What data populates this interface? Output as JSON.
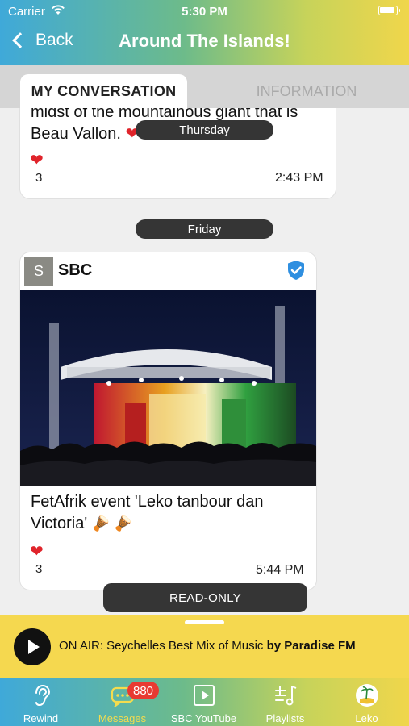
{
  "status_bar": {
    "carrier": "Carrier",
    "time": "5:30 PM"
  },
  "nav": {
    "back_label": "Back",
    "title": "Around The Islands!"
  },
  "tabs": [
    {
      "label": "MY CONVERSATION",
      "active": true
    },
    {
      "label": "INFORMATION",
      "active": false
    }
  ],
  "messages": [
    {
      "text": "midst of the mountainous giant that is Beau Vallon. ",
      "reaction_icon": "heart-icon",
      "reaction_count": "3",
      "time": "2:43 PM"
    },
    {
      "sender_initial": "S",
      "sender": "SBC",
      "image": "concert-stage-photo",
      "text": "FetAfrik event 'Leko tanbour dan Victoria' ",
      "reaction_icon": "heart-icon",
      "reaction_count": "3",
      "time": "5:44 PM"
    }
  ],
  "day_separators": [
    "Thursday",
    "Friday"
  ],
  "read_only_label": "READ-ONLY",
  "player": {
    "prefix": "ON AIR: Seychelles Best Mix of Music ",
    "station": "by Paradise FM"
  },
  "tabbar": {
    "items": [
      {
        "label": "Rewind",
        "icon": "ear-icon"
      },
      {
        "label": "Messages",
        "icon": "chat-bubble-icon",
        "badge": "880",
        "active": true
      },
      {
        "label": "SBC YouTube",
        "icon": "play-square-icon"
      },
      {
        "label": "Playlists",
        "icon": "playlist-icon"
      },
      {
        "label": "Leko",
        "icon": "leko-logo-icon"
      }
    ]
  },
  "colors": {
    "header_start": "#3fa9d9",
    "header_end": "#f0d64b",
    "player_bg": "#f5d84f",
    "pill_bg": "#353535",
    "badge": "#e83a32",
    "verified": "#2f8fe0"
  }
}
